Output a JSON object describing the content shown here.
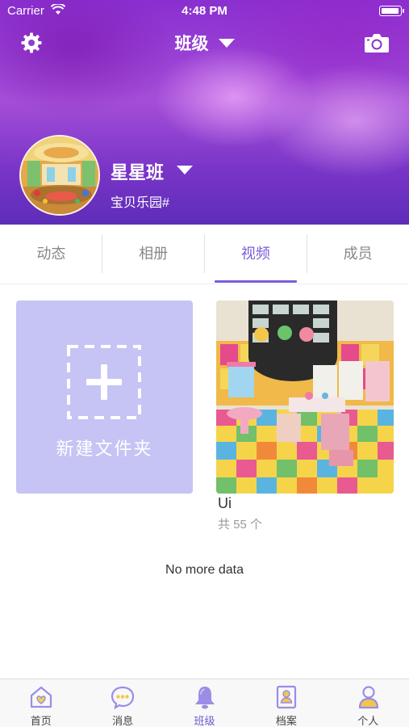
{
  "status_bar": {
    "carrier": "Carrier",
    "time": "4:48 PM"
  },
  "header": {
    "title": "班级",
    "class_name": "星星班",
    "school_name": "宝贝乐园#"
  },
  "tabs": [
    {
      "label": "动态",
      "active": false
    },
    {
      "label": "相册",
      "active": false
    },
    {
      "label": "视频",
      "active": true
    },
    {
      "label": "成员",
      "active": false
    }
  ],
  "new_folder": {
    "label": "新建文件夹"
  },
  "videos": [
    {
      "name": "Ui",
      "count": "共 55 个"
    }
  ],
  "footer_text": "No more data",
  "bottom_nav": [
    {
      "label": "首页",
      "icon": "home-heart-icon",
      "active": false
    },
    {
      "label": "消息",
      "icon": "message-bubble-icon",
      "active": false
    },
    {
      "label": "班级",
      "icon": "bell-icon",
      "active": true
    },
    {
      "label": "档案",
      "icon": "profile-card-icon",
      "active": false
    },
    {
      "label": "个人",
      "icon": "person-icon",
      "active": false
    }
  ],
  "colors": {
    "accent": "#7b5cd6",
    "header_purple": "#8a2fd0",
    "new_folder_bg": "#c5c4f4",
    "nav_icon": "#9b8de6"
  }
}
